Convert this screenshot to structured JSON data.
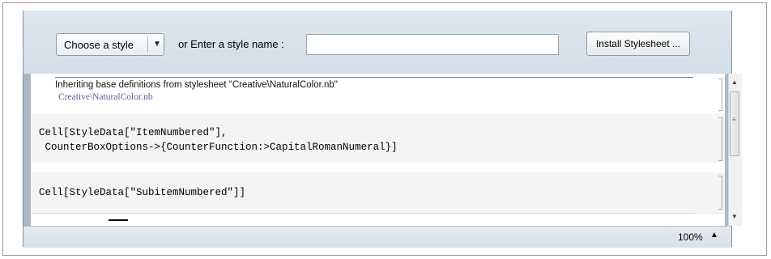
{
  "toolbar": {
    "style_button_label": "Choose a style",
    "or_label": "or  Enter a style name :",
    "style_name_value": "",
    "install_button_label": "Install Stylesheet ..."
  },
  "cells": {
    "inherit_text": "Inheriting base definitions from stylesheet \"Creative\\NaturalColor.nb\"",
    "inherit_link": "Creative\\NaturalColor.nb",
    "item_numbered_line1": "Cell[StyleData[\"ItemNumbered\"],",
    "item_numbered_line2": " CounterBoxOptions->{CounterFunction:>CapitalRomanNumeral}]",
    "subitem_numbered": "Cell[StyleData[\"SubitemNumbered\"]]"
  },
  "statusbar": {
    "zoom": "100%"
  },
  "icons": {
    "dropdown": "chevron-down-icon",
    "scroll_up": "arrow-up-icon",
    "scroll_down": "arrow-down-icon",
    "zoom_menu": "arrow-up-icon"
  }
}
